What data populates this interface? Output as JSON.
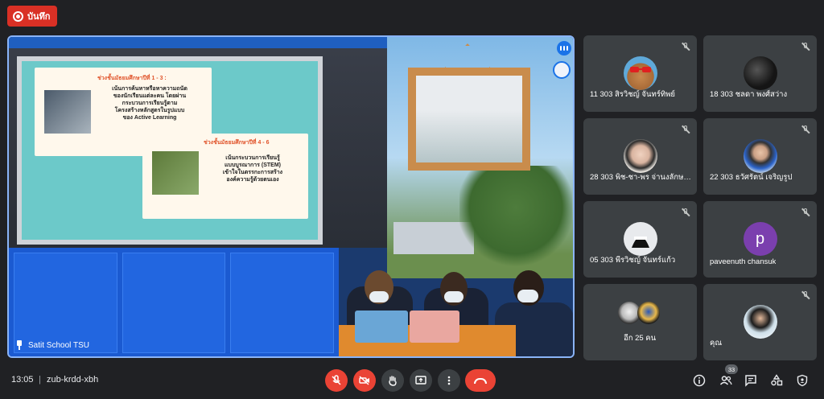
{
  "recording": {
    "label": "บันทึก"
  },
  "main": {
    "presenter_name": "Satit School TSU",
    "slide": {
      "heading1": "ช่วงชั้นมัธยมศึกษาปีที่ 1 - 3 :",
      "text1": "เน้นการค้นหาหรือหาความถนัด\nของนักเรียนแต่ละคน โดยผ่าน\nกระบวนการเรียนรู้ตาม\nโครงสร้างหลักสูตรในรูปแบบ\nของ Active Learning",
      "heading2": "ช่วงชั้นมัธยมศึกษาปีที่ 4 - 6",
      "text2": "เน้นกระบวนการเรียนรู้\nแบบบูรณาการ (STEM)\nเข้าใจในตรรกะการสร้าง\nองค์ความรู้ด้วยตนเอง"
    }
  },
  "participants": [
    {
      "name": "11 303 สิรวิชญ์ จันทร์ทิพย์",
      "avatar": "dog-photo",
      "muted": true
    },
    {
      "name": "18 303 ชลดา พงศ์สว่าง",
      "avatar": "dark-photo",
      "muted": true
    },
    {
      "name": "28 303 พิช-ชา-พร จ่านงลักษ…",
      "avatar": "girl-photo",
      "muted": true
    },
    {
      "name": "22 303 ธวัศรัตน์ เจริญรูป",
      "avatar": "girl-blue-photo",
      "muted": true
    },
    {
      "name": "05 303 พีรวิชญ์ จันทร์แก้ว",
      "avatar": "masked-face-photo",
      "muted": true
    },
    {
      "name": "paveenuth chansuk",
      "avatar_letter": "p",
      "avatar_color": "#7b3fae",
      "muted": true
    },
    {
      "name": "อีก 25 คน",
      "avatar": "group-photos"
    },
    {
      "name": "คุณ",
      "avatar": "self-photo",
      "muted": true
    }
  ],
  "bottom_bar": {
    "time": "13:05",
    "separator": "|",
    "meeting_code": "zub-krdd-xbh",
    "people_count": "33",
    "controls": [
      "mic-off-icon",
      "camera-off-icon",
      "raise-hand-icon",
      "present-icon",
      "more-options-icon",
      "hang-up-icon"
    ],
    "right_icons": [
      "info-icon",
      "people-icon",
      "chat-icon",
      "activities-icon",
      "host-controls-icon"
    ]
  },
  "colors": {
    "accent": "#8ab4f8",
    "danger": "#ea4335",
    "tile": "#3c4043",
    "background": "#202124"
  }
}
